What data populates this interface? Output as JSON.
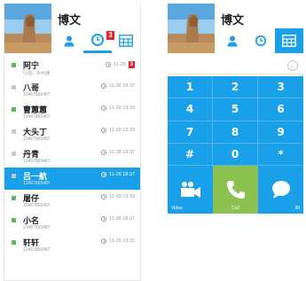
{
  "colors": {
    "accent": "#1aa0e8",
    "call": "#8cc152",
    "badge": "#e8202a",
    "online": "#5cb85c",
    "offline": "#c8c8c8"
  },
  "left": {
    "header": {
      "name": "博文"
    },
    "tabs": [
      {
        "icon": "user-icon",
        "active": false
      },
      {
        "icon": "recent-calls-icon",
        "active": true,
        "badge": "3"
      },
      {
        "icon": "keypad-icon",
        "active": false
      }
    ],
    "contacts": [
      {
        "name": "阿宁",
        "sub": "行动，杂州通",
        "time": "11-29",
        "missed": "3",
        "status": "online",
        "selected": false
      },
      {
        "name": "八哥",
        "sub": "13467865487",
        "time": "11-28 18:37",
        "status": "offline",
        "selected": false
      },
      {
        "name": "曹蕙蕙",
        "sub": "13467865487",
        "time": "11-29 13:33",
        "status": "online",
        "selected": false
      },
      {
        "name": "大头丁",
        "sub": "13467865487",
        "time": "11-29 13:33",
        "status": "offline",
        "selected": false
      },
      {
        "name": "丹青",
        "sub": "13467865487",
        "time": "11-28 18:37",
        "status": "offline",
        "selected": false
      },
      {
        "name": "吕一航",
        "sub": "13467865487",
        "time": "11-28 18:37",
        "status": "offline",
        "selected": true
      },
      {
        "name": "屠仔",
        "sub": "13467865487",
        "time": "11-29 13:33",
        "status": "online",
        "selected": false
      },
      {
        "name": "小名",
        "sub": "13467865487",
        "time": "11-28 18:37",
        "status": "online",
        "selected": false
      },
      {
        "name": "轩轩",
        "sub": "13467865487",
        "time": "11-29 13:33",
        "status": "online",
        "selected": false
      }
    ]
  },
  "right": {
    "header": {
      "name": "博文"
    },
    "tabs": [
      {
        "icon": "user-icon",
        "active": false
      },
      {
        "icon": "recent-calls-icon",
        "active": false
      },
      {
        "icon": "keypad-icon",
        "active": true
      }
    ],
    "keys": [
      "1",
      "2",
      "3",
      "4",
      "5",
      "6",
      "7",
      "8",
      "9",
      "#",
      "0",
      "*"
    ],
    "actions": {
      "video": "Video",
      "call": "Call",
      "im": "IM"
    }
  }
}
